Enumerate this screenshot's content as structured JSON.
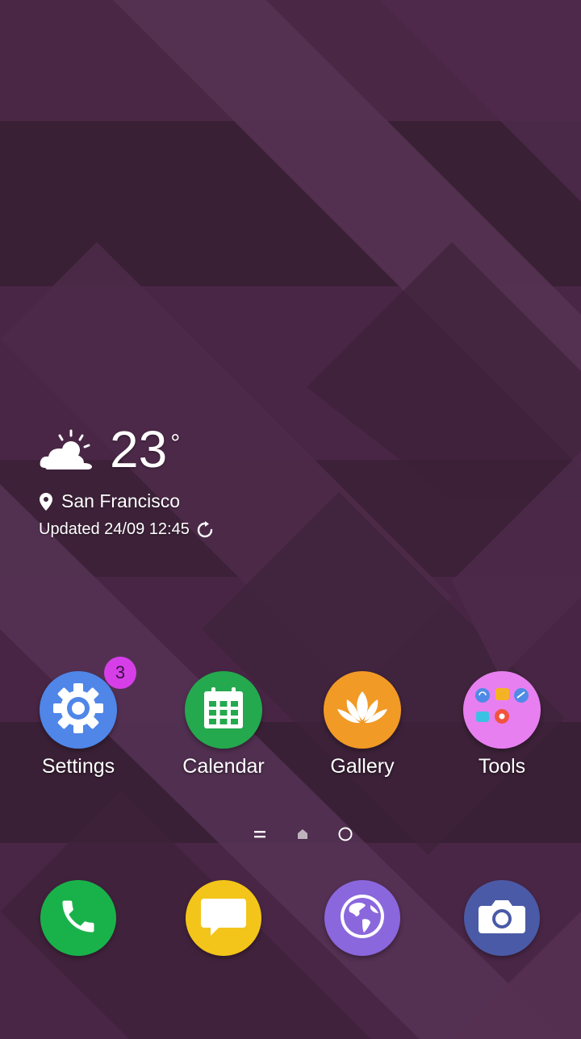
{
  "weather": {
    "temperature": "23",
    "degree_symbol": "°",
    "location": "San Francisco",
    "updated": "Updated 24/09 12:45",
    "condition_icon": "partly-sunny-icon"
  },
  "apps": [
    {
      "label": "Settings",
      "icon": "gear-icon",
      "color": "#4f86e8",
      "badge": "3"
    },
    {
      "label": "Calendar",
      "icon": "calendar-icon",
      "color": "#24a94f"
    },
    {
      "label": "Gallery",
      "icon": "lotus-icon",
      "color": "#f19a25"
    },
    {
      "label": "Tools",
      "icon": "folder-icon",
      "color": "#e77ff0"
    }
  ],
  "page_indicators": [
    "menu",
    "home",
    "page"
  ],
  "dock": [
    {
      "name": "phone",
      "icon": "phone-icon",
      "color": "#19b24a"
    },
    {
      "name": "messages",
      "icon": "message-icon",
      "color": "#f3c51a"
    },
    {
      "name": "browser",
      "icon": "globe-icon",
      "color": "#8a67dd"
    },
    {
      "name": "camera",
      "icon": "camera-icon",
      "color": "#4a5aa6"
    }
  ],
  "colors": {
    "wallpaper_dark": "#2e1a2d",
    "wallpaper_mid": "#4a2648",
    "wallpaper_light": "#5a3656",
    "badge": "#d63fe8"
  }
}
